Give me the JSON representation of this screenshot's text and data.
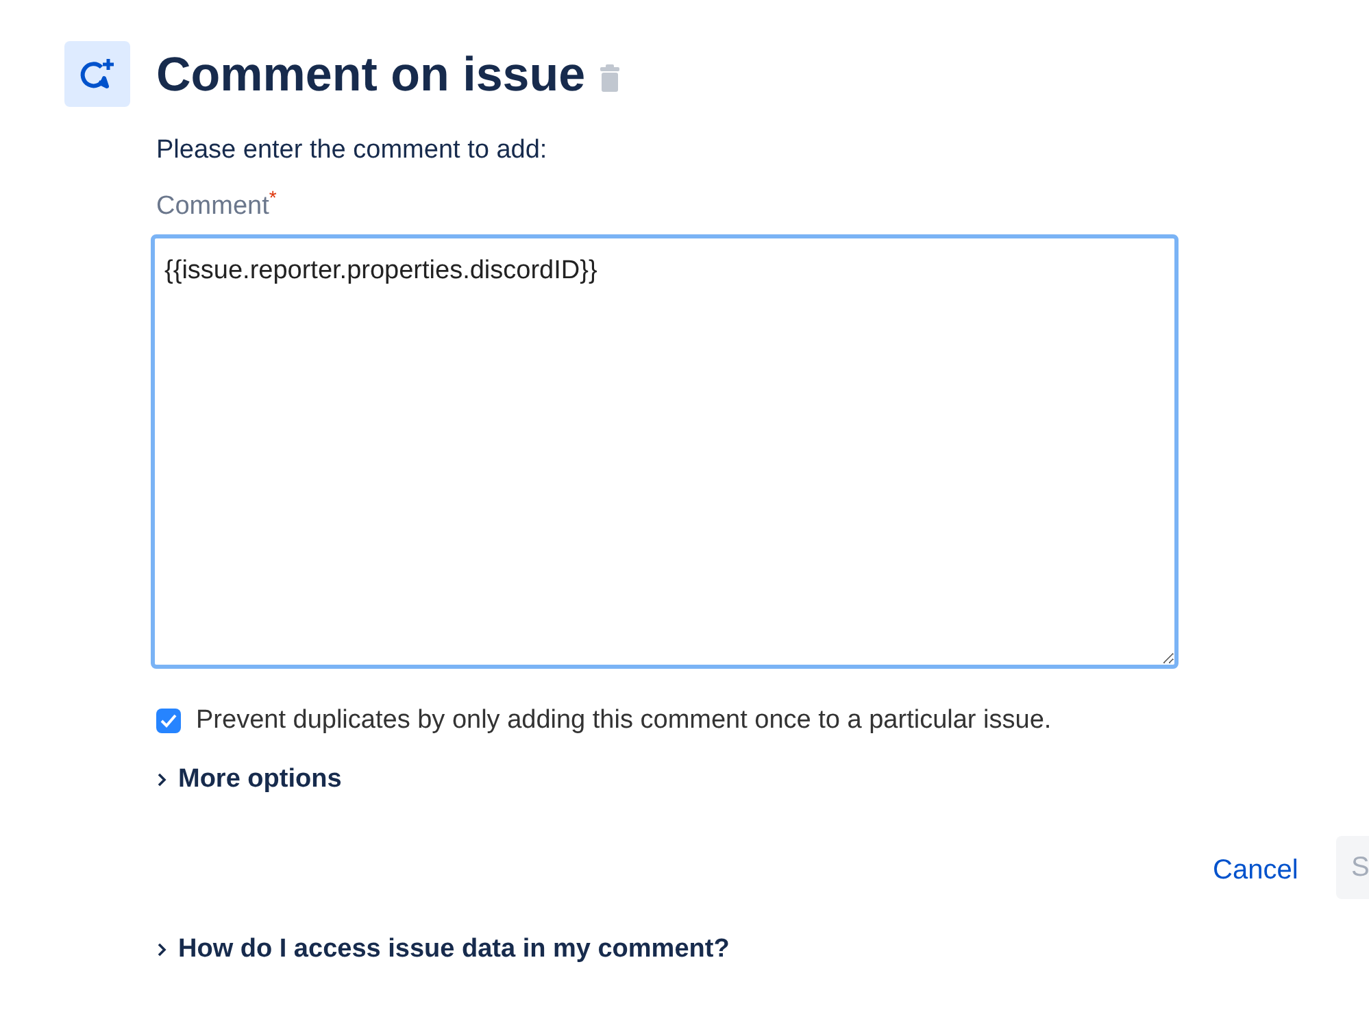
{
  "header": {
    "title": "Comment on issue"
  },
  "form": {
    "instruction": "Please enter the comment to add:",
    "field_label": "Comment",
    "required_mark": "*",
    "comment_value": "{{issue.reporter.properties.discordID}}"
  },
  "prevent_duplicates": {
    "label": "Prevent duplicates by only adding this comment once to a particular issue.",
    "checked": true
  },
  "more_options": {
    "label": "More options",
    "expanded": false
  },
  "actions": {
    "cancel": "Cancel",
    "save": "S"
  },
  "help": {
    "label": "How do I access issue data in my comment?",
    "expanded": false
  }
}
